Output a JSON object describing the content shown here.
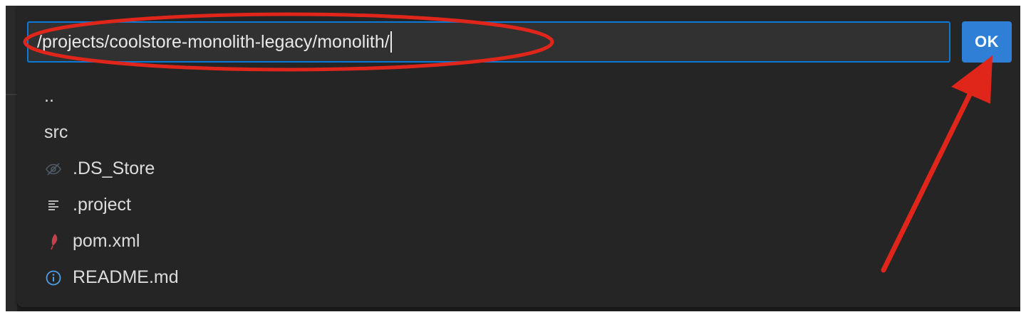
{
  "dialog": {
    "path_value": "/projects/coolstore-monolith-legacy/monolith/",
    "ok_label": "OK"
  },
  "entries": [
    {
      "label": "..",
      "icon": "none"
    },
    {
      "label": "src",
      "icon": "none"
    },
    {
      "label": ".DS_Store",
      "icon": "eye-slash-icon"
    },
    {
      "label": ".project",
      "icon": "text-lines-icon"
    },
    {
      "label": "pom.xml",
      "icon": "feather-icon"
    },
    {
      "label": "README.md",
      "icon": "info-icon"
    }
  ],
  "colors": {
    "accent": "#2f7fd6",
    "focus_border": "#0a7ad8",
    "annotation": "#e0261b",
    "background": "#252526",
    "text": "#dcdcdc"
  }
}
